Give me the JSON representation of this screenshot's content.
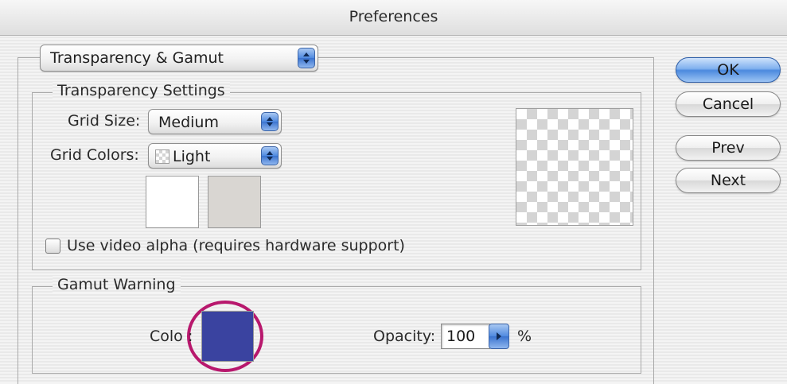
{
  "window": {
    "title": "Preferences"
  },
  "panel_select": {
    "value": "Transparency & Gamut"
  },
  "transparency": {
    "legend": "Transparency Settings",
    "grid_size_label": "Grid Size:",
    "grid_size_value": "Medium",
    "grid_colors_label": "Grid Colors:",
    "grid_colors_value": "Light",
    "swatch_light_color": "#ffffff",
    "swatch_dark_color": "#d9d6d2",
    "video_alpha_label": "Use video alpha (requires hardware support)",
    "video_alpha_checked": false
  },
  "gamut": {
    "legend": "Gamut Warning",
    "color_label": "Colo",
    "color_label_tail": ":",
    "color_value": "#3a43a0",
    "highlight_color": "#b8186d",
    "opacity_label": "Opacity:",
    "opacity_value": "100",
    "opacity_unit": "%"
  },
  "buttons": {
    "ok": "OK",
    "cancel": "Cancel",
    "prev": "Prev",
    "next": "Next"
  }
}
